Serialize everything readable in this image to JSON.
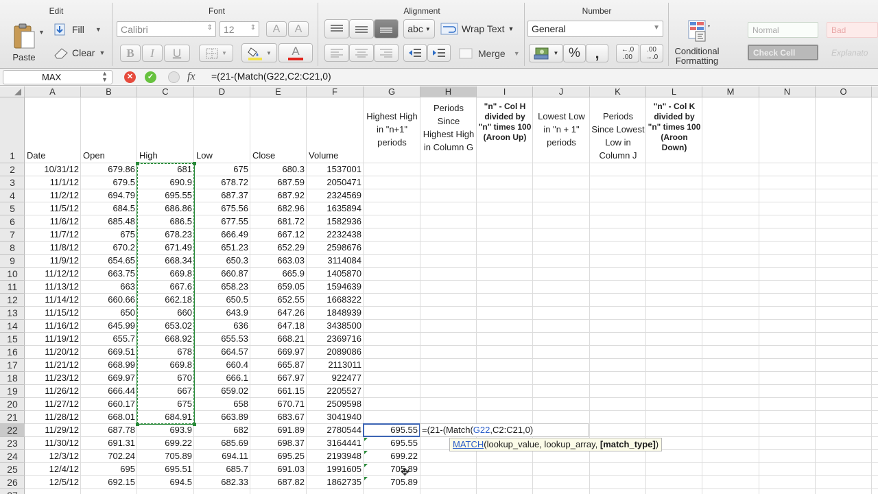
{
  "ribbon": {
    "groups": {
      "edit": "Edit",
      "font": "Font",
      "alignment": "Alignment",
      "number": "Number"
    },
    "edit": {
      "paste": "Paste",
      "fill": "Fill",
      "clear": "Clear"
    },
    "font": {
      "name": "Calibri",
      "size": "12",
      "bold": "B",
      "italic": "I",
      "underline": "U",
      "grow": "A",
      "shrink": "A",
      "color": "A"
    },
    "alignment": {
      "abc": "abc",
      "wrap_text": "Wrap Text",
      "merge": "Merge"
    },
    "number": {
      "format": "General",
      "percent": "%",
      "comma": ",",
      "inc_decimal_top": "←.0",
      "inc_decimal_bottom": ".00",
      "dec_decimal_top": ".00",
      "dec_decimal_bottom": "→.0"
    },
    "conditional": {
      "line1": "Conditional",
      "line2": "Formatting"
    },
    "styles": {
      "normal": "Normal",
      "bad": "Bad",
      "check_cell": "Check Cell",
      "explanatory": "Explanato"
    },
    "colors": {
      "accent_blue": "#3c64b4",
      "selection_green": "#2a8a3a",
      "font_red": "#e0241c",
      "fill_yellow": "#f4e24a"
    }
  },
  "formula_bar": {
    "name_box": "MAX",
    "fx": "fx",
    "formula": "=(21-(Match(G22,C2:C21,0)"
  },
  "columns": [
    "A",
    "B",
    "C",
    "D",
    "E",
    "F",
    "G",
    "H",
    "I",
    "J",
    "K",
    "L",
    "M",
    "N",
    "O"
  ],
  "row_numbers": [
    "1",
    "2",
    "3",
    "4",
    "5",
    "6",
    "7",
    "8",
    "9",
    "10",
    "11",
    "12",
    "13",
    "14",
    "15",
    "16",
    "17",
    "18",
    "19",
    "20",
    "21",
    "22",
    "23",
    "24",
    "25",
    "26",
    "27"
  ],
  "header_row": {
    "A": "Date",
    "B": "Open",
    "C": "High",
    "D": "Low",
    "E": "Close",
    "F": "Volume",
    "G": "Highest High in \"n+1\" periods",
    "H": "Periods Since Highest High in Column G",
    "I": "\"n\" - Col H divided by \"n\" times 100 (Aroon Up)",
    "J": "Lowest Low in \"n + 1\" periods",
    "K": "Periods Since Lowest Low in Column J",
    "L": "\"n\" - Col K divided by \"n\" times 100 (Aroon Down)"
  },
  "rows": [
    [
      "10/31/12",
      "679.86",
      "681",
      "675",
      "680.3",
      "1537001"
    ],
    [
      "11/1/12",
      "679.5",
      "690.9",
      "678.72",
      "687.59",
      "2050471"
    ],
    [
      "11/2/12",
      "694.79",
      "695.55",
      "687.37",
      "687.92",
      "2324569"
    ],
    [
      "11/5/12",
      "684.5",
      "686.86",
      "675.56",
      "682.96",
      "1635894"
    ],
    [
      "11/6/12",
      "685.48",
      "686.5",
      "677.55",
      "681.72",
      "1582936"
    ],
    [
      "11/7/12",
      "675",
      "678.23",
      "666.49",
      "667.12",
      "2232438"
    ],
    [
      "11/8/12",
      "670.2",
      "671.49",
      "651.23",
      "652.29",
      "2598676"
    ],
    [
      "11/9/12",
      "654.65",
      "668.34",
      "650.3",
      "663.03",
      "3114084"
    ],
    [
      "11/12/12",
      "663.75",
      "669.8",
      "660.87",
      "665.9",
      "1405870"
    ],
    [
      "11/13/12",
      "663",
      "667.6",
      "658.23",
      "659.05",
      "1594639"
    ],
    [
      "11/14/12",
      "660.66",
      "662.18",
      "650.5",
      "652.55",
      "1668322"
    ],
    [
      "11/15/12",
      "650",
      "660",
      "643.9",
      "647.26",
      "1848939"
    ],
    [
      "11/16/12",
      "645.99",
      "653.02",
      "636",
      "647.18",
      "3438500"
    ],
    [
      "11/19/12",
      "655.7",
      "668.92",
      "655.53",
      "668.21",
      "2369716"
    ],
    [
      "11/20/12",
      "669.51",
      "678",
      "664.57",
      "669.97",
      "2089086"
    ],
    [
      "11/21/12",
      "668.99",
      "669.8",
      "660.4",
      "665.87",
      "2113011"
    ],
    [
      "11/23/12",
      "669.97",
      "670",
      "666.1",
      "667.97",
      "922477"
    ],
    [
      "11/26/12",
      "666.44",
      "667",
      "659.02",
      "661.15",
      "2205527"
    ],
    [
      "11/27/12",
      "660.17",
      "675",
      "658",
      "670.71",
      "2509598"
    ],
    [
      "11/28/12",
      "668.01",
      "684.91",
      "663.89",
      "683.67",
      "3041940"
    ],
    [
      "11/29/12",
      "687.78",
      "693.9",
      "682",
      "691.89",
      "2780544"
    ],
    [
      "11/30/12",
      "691.31",
      "699.22",
      "685.69",
      "698.37",
      "3164441"
    ],
    [
      "12/3/12",
      "702.24",
      "705.89",
      "694.11",
      "695.25",
      "2193948"
    ],
    [
      "12/4/12",
      "695",
      "695.51",
      "685.7",
      "691.03",
      "1991605"
    ],
    [
      "12/5/12",
      "692.15",
      "694.5",
      "682.33",
      "687.82",
      "1862735"
    ]
  ],
  "col_g_values": {
    "22": "695.55",
    "23": "695.55",
    "24": "699.22",
    "25": "705.89",
    "26": "705.89"
  },
  "inline_edit": {
    "prefix": "=(21-(Match(",
    "ref1": "G22",
    "rest": ",C2:C21,0)"
  },
  "tooltip": {
    "func": "MATCH",
    "args": "(lookup_value, lookup_array, ",
    "bold_arg": "[match_type]",
    "close": ")"
  }
}
